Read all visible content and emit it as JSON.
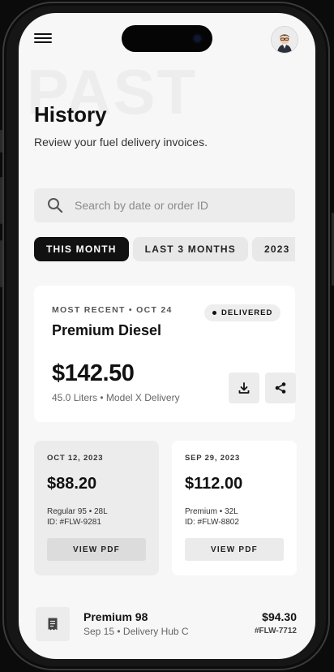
{
  "watermark": "PAST",
  "header": {
    "title": "History",
    "subtitle": "Review your fuel delivery invoices."
  },
  "search": {
    "placeholder": "Search by date or order ID",
    "value": ""
  },
  "tabs": [
    {
      "label": "THIS MONTH",
      "active": true
    },
    {
      "label": "LAST 3 MONTHS",
      "active": false
    },
    {
      "label": "2023",
      "active": false
    }
  ],
  "featured": {
    "eyebrow": "MOST RECENT • OCT 24",
    "status": "DELIVERED",
    "product": "Premium Diesel",
    "price": "$142.50",
    "meta": "45.0 Liters • Model X Delivery",
    "actions": [
      "download-icon",
      "share-icon"
    ]
  },
  "invoices": [
    {
      "date": "OCT 12, 2023",
      "amount": "$88.20",
      "detail": "Regular 95 • 28L",
      "order_id": "ID: #FLW-9281",
      "button": "VIEW PDF"
    },
    {
      "date": "SEP 29, 2023",
      "amount": "$112.00",
      "detail": "Premium • 32L",
      "order_id": "ID: #FLW-8802",
      "button": "VIEW PDF"
    }
  ],
  "list": [
    {
      "title": "Premium 98",
      "subtitle": "Sep 15 • Delivery Hub C",
      "amount": "$94.30",
      "order_id": "#FLW-7712",
      "icon": "receipt-icon"
    }
  ],
  "colors": {
    "background": "#f7f7f7",
    "accent": "#111111",
    "card": "#ffffff",
    "muted_card": "#ececec"
  }
}
